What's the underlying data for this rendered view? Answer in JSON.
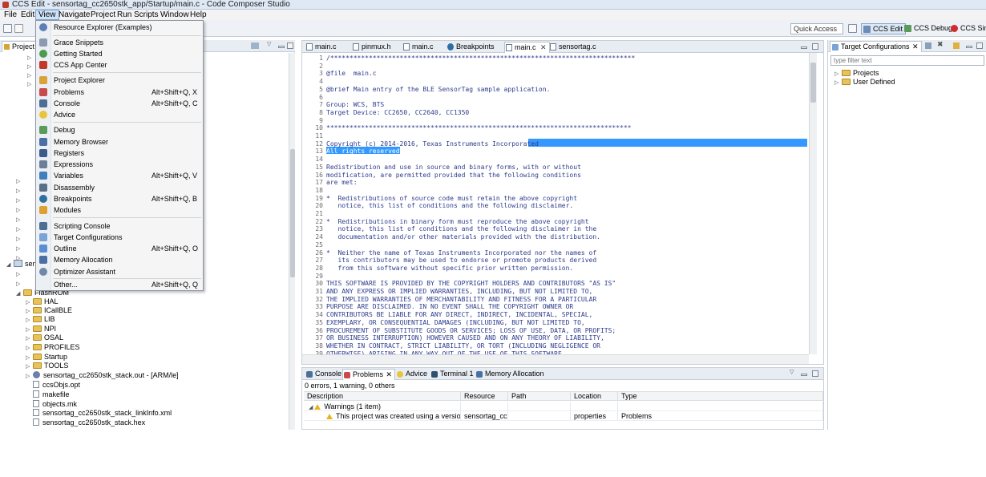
{
  "window": {
    "title": "CCS Edit - sensortag_cc2650stk_app/Startup/main.c - Code Composer Studio"
  },
  "menubar": [
    "File",
    "Edit",
    "View",
    "Navigate",
    "Project",
    "Run",
    "Scripts",
    "Window",
    "Help"
  ],
  "toolbar": {
    "quick_access": "Quick Access",
    "perspectives": [
      "CCS Edit",
      "CCS Debug",
      "CCS Simp"
    ]
  },
  "view_menu": {
    "items": [
      {
        "label": "Resource Explorer (Examples)",
        "shortcut": "",
        "icon": "globe-icon"
      },
      {
        "label": "Grace Snippets",
        "shortcut": "",
        "icon": "snippets-icon"
      },
      {
        "label": "Getting Started",
        "shortcut": "",
        "icon": "getting-started-icon"
      },
      {
        "label": "CCS App Center",
        "shortcut": "",
        "icon": "app-center-icon"
      },
      {
        "label": "Project Explorer",
        "shortcut": "",
        "icon": "project-explorer-icon"
      },
      {
        "label": "Problems",
        "shortcut": "Alt+Shift+Q, X",
        "icon": "problems-icon"
      },
      {
        "label": "Console",
        "shortcut": "Alt+Shift+Q, C",
        "icon": "console-icon"
      },
      {
        "label": "Advice",
        "shortcut": "",
        "icon": "advice-icon"
      },
      {
        "label": "Debug",
        "shortcut": "",
        "icon": "debug-icon"
      },
      {
        "label": "Memory Browser",
        "shortcut": "",
        "icon": "memory-browser-icon"
      },
      {
        "label": "Registers",
        "shortcut": "",
        "icon": "registers-icon"
      },
      {
        "label": "Expressions",
        "shortcut": "",
        "icon": "expressions-icon"
      },
      {
        "label": "Variables",
        "shortcut": "Alt+Shift+Q, V",
        "icon": "variables-icon"
      },
      {
        "label": "Disassembly",
        "shortcut": "",
        "icon": "disassembly-icon"
      },
      {
        "label": "Breakpoints",
        "shortcut": "Alt+Shift+Q, B",
        "icon": "breakpoints-icon"
      },
      {
        "label": "Modules",
        "shortcut": "",
        "icon": "modules-icon"
      },
      {
        "label": "Scripting Console",
        "shortcut": "",
        "icon": "scripting-console-icon"
      },
      {
        "label": "Target Configurations",
        "shortcut": "",
        "icon": "target-config-icon"
      },
      {
        "label": "Outline",
        "shortcut": "Alt+Shift+Q, O",
        "icon": "outline-icon"
      },
      {
        "label": "Memory Allocation",
        "shortcut": "",
        "icon": "memory-allocation-icon"
      },
      {
        "label": "Optimizer Assistant",
        "shortcut": "",
        "icon": "optimizer-icon"
      },
      {
        "label": "Other...",
        "shortcut": "Alt+Shift+Q, Q",
        "icon": "other-icon"
      }
    ]
  },
  "left_panel": {
    "tab": "Project",
    "tree_partial": [
      "sen",
      "FlashROM"
    ],
    "tree": [
      {
        "label": "HAL",
        "kind": "folder"
      },
      {
        "label": "ICallBLE",
        "kind": "folder"
      },
      {
        "label": "LIB",
        "kind": "folder"
      },
      {
        "label": "NPI",
        "kind": "folder"
      },
      {
        "label": "OSAL",
        "kind": "folder"
      },
      {
        "label": "PROFILES",
        "kind": "folder"
      },
      {
        "label": "Startup",
        "kind": "folder"
      },
      {
        "label": "TOOLS",
        "kind": "folder"
      },
      {
        "label": "sensortag_cc2650stk_stack.out - [ARM/le]",
        "kind": "binary"
      },
      {
        "label": "ccsObjs.opt",
        "kind": "file"
      },
      {
        "label": "makefile",
        "kind": "file"
      },
      {
        "label": "objects.mk",
        "kind": "file"
      },
      {
        "label": "sensortag_cc2650stk_stack_linkInfo.xml",
        "kind": "file"
      },
      {
        "label": "sensortag_cc2650stk_stack.hex",
        "kind": "file"
      }
    ]
  },
  "editor": {
    "tabs": [
      {
        "label": "main.c",
        "active": false
      },
      {
        "label": "pinmux.h",
        "active": false
      },
      {
        "label": "main.c",
        "active": false
      },
      {
        "label": "Breakpoints",
        "active": false
      },
      {
        "label": "main.c",
        "active": true
      },
      {
        "label": "sensortag.c",
        "active": false
      }
    ],
    "lines": [
      "/*******************************************************************************",
      "",
      "@file  main.c",
      "",
      "@brief Main entry of the BLE SensorTag sample application.",
      "",
      "Group: WCS, BTS",
      "Target Device: CC2650, CC2640, CC1350",
      "",
      "*******************************************************************************",
      "",
      "Copyright (c) 2014-2016, Texas Instruments Incorporated",
      "All rights reserved.",
      "",
      "Redistribution and use in source and binary forms, with or without",
      "modification, are permitted provided that the following conditions",
      "are met:",
      "",
      "*  Redistributions of source code must retain the above copyright",
      "   notice, this list of conditions and the following disclaimer.",
      "",
      "*  Redistributions in binary form must reproduce the above copyright",
      "   notice, this list of conditions and the following disclaimer in the",
      "   documentation and/or other materials provided with the distribution.",
      "",
      "*  Neither the name of Texas Instruments Incorporated nor the names of",
      "   its contributors may be used to endorse or promote products derived",
      "   from this software without specific prior written permission.",
      "",
      "THIS SOFTWARE IS PROVIDED BY THE COPYRIGHT HOLDERS AND CONTRIBUTORS \"AS IS\"",
      "AND ANY EXPRESS OR IMPLIED WARRANTIES, INCLUDING, BUT NOT LIMITED TO,",
      "THE IMPLIED WARRANTIES OF MERCHANTABILITY AND FITNESS FOR A PARTICULAR",
      "PURPOSE ARE DISCLAIMED. IN NO EVENT SHALL THE COPYRIGHT OWNER OR",
      "CONTRIBUTORS BE LIABLE FOR ANY DIRECT, INDIRECT, INCIDENTAL, SPECIAL,",
      "EXEMPLARY, OR CONSEQUENTIAL DAMAGES (INCLUDING, BUT NOT LIMITED TO,",
      "PROCUREMENT OF SUBSTITUTE GOODS OR SERVICES; LOSS OF USE, DATA, OR PROFITS;",
      "OR BUSINESS INTERRUPTION) HOWEVER CAUSED AND ON ANY THEORY OF LIABILITY,",
      "WHETHER IN CONTRACT, STRICT LIABILITY, OR TORT (INCLUDING NEGLIGENCE OR",
      "OTHERWISE) ARISING IN ANY WAY OUT OF THE USE OF THIS SOFTWARE"
    ],
    "selected_lines": [
      12,
      13
    ]
  },
  "problems_panel": {
    "tabs": [
      {
        "label": "Console",
        "active": false
      },
      {
        "label": "Problems",
        "active": true
      },
      {
        "label": "Advice",
        "active": false
      },
      {
        "label": "Terminal 1",
        "active": false
      },
      {
        "label": "Memory Allocation",
        "active": false
      }
    ],
    "summary": "0 errors, 1 warning, 0 others",
    "columns": [
      "Description",
      "Resource",
      "Path",
      "Location",
      "Type"
    ],
    "group": "Warnings (1 item)",
    "rows": [
      {
        "description": "This project was created using a version of cc",
        "resource": "sensortag_cc...",
        "path": "",
        "location": "properties",
        "type": "Problems"
      }
    ]
  },
  "right_panel": {
    "tab": "Target Configurations",
    "filter_placeholder": "type filter text",
    "tree": [
      "Projects",
      "User Defined"
    ]
  },
  "colors": {
    "selection": "#3399ff",
    "code_text": "#2d3c8c",
    "menu_highlight": "#cfe3f8"
  }
}
